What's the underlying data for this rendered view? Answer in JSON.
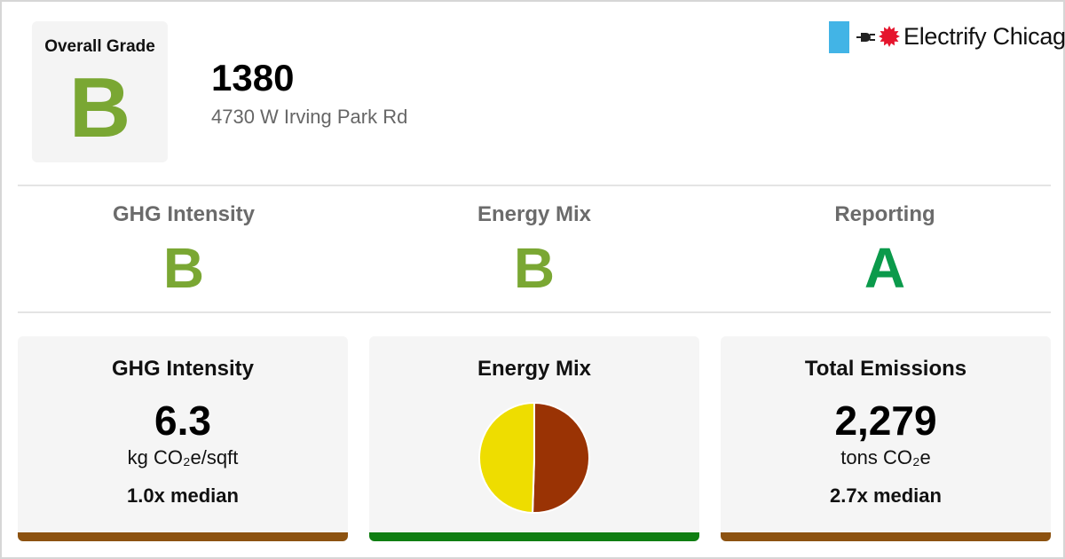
{
  "header": {
    "overall_label": "Overall Grade",
    "overall_grade": "B",
    "building_name": "1380",
    "address": "4730 W Irving Park Rd",
    "logo_text": "Electrify Chicago"
  },
  "grades": [
    {
      "label": "GHG Intensity",
      "grade": "B",
      "color": "#7aa733"
    },
    {
      "label": "Energy Mix",
      "grade": "B",
      "color": "#7aa733"
    },
    {
      "label": "Reporting",
      "grade": "A",
      "color": "#0b9a4b"
    }
  ],
  "cards": {
    "ghg": {
      "title": "GHG Intensity",
      "value": "6.3",
      "unit": "kg CO₂e/sqft",
      "median": "1.0x median",
      "bar_color": "#8c5210"
    },
    "mix": {
      "title": "Energy Mix",
      "bar_color": "#0f7e12",
      "slices": [
        {
          "color": "#9a3304",
          "fraction": 0.505
        },
        {
          "color": "#eedd00",
          "fraction": 0.495
        }
      ]
    },
    "emissions": {
      "title": "Total Emissions",
      "value": "2,279",
      "unit": "tons CO₂e",
      "median": "2.7x median",
      "bar_color": "#8c5210"
    }
  },
  "colors": {
    "grade_b": "#7aa733",
    "grade_a": "#0b9a4b",
    "logo_blue": "#42b4e6",
    "logo_red": "#e5152d"
  },
  "icons": [
    "chicago-flag-icon",
    "plug-icon",
    "chicago-star-icon"
  ]
}
